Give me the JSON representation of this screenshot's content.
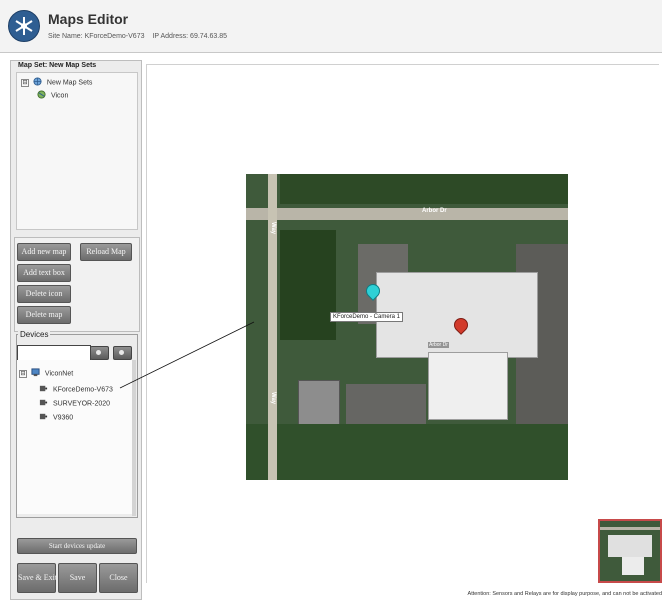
{
  "header": {
    "title": "Maps Editor",
    "site_name": "Site Name: KForceDemo-V673",
    "ip_address": "IP Address: 69.74.63.85"
  },
  "map_set": {
    "title": "Map Set: New Map Sets",
    "tree": [
      {
        "label": "New Map Sets",
        "expander": "⊟"
      },
      {
        "label": "Vicon"
      }
    ]
  },
  "map_buttons": {
    "add_new_map": "Add new map",
    "reload_map": "Reload Map",
    "add_text_box": "Add text box",
    "delete_icon": "Delete icon",
    "delete_map": "Delete map"
  },
  "devices": {
    "label": "Devices",
    "search_value": "",
    "tree": [
      {
        "label": "ViconNet",
        "expander": "⊟"
      },
      {
        "label": "KForceDemo-V673"
      },
      {
        "label": "SURVEYOR-2020"
      },
      {
        "label": "V9360"
      }
    ],
    "start_update_label": "Start devices update"
  },
  "bottom_buttons": {
    "save_exit": "Save & Exit",
    "save": "Save",
    "close": "Close"
  },
  "map": {
    "streets": [
      "Arbor Dr",
      "Way",
      "Way"
    ],
    "camera_label": "KForceDemo - Camera 1",
    "marker_label": "Arbor Dr"
  },
  "status": {
    "attention": "Attention: Sensors and Relays are for display purpose, and can not be activated"
  },
  "colors": {
    "button_gray": "#6c6c6c",
    "camera_pin": "#2ed0d6",
    "marker_pin": "#d23b2b",
    "thumbnail_border": "#c74a4a",
    "app_logo": "#2f5e92"
  }
}
